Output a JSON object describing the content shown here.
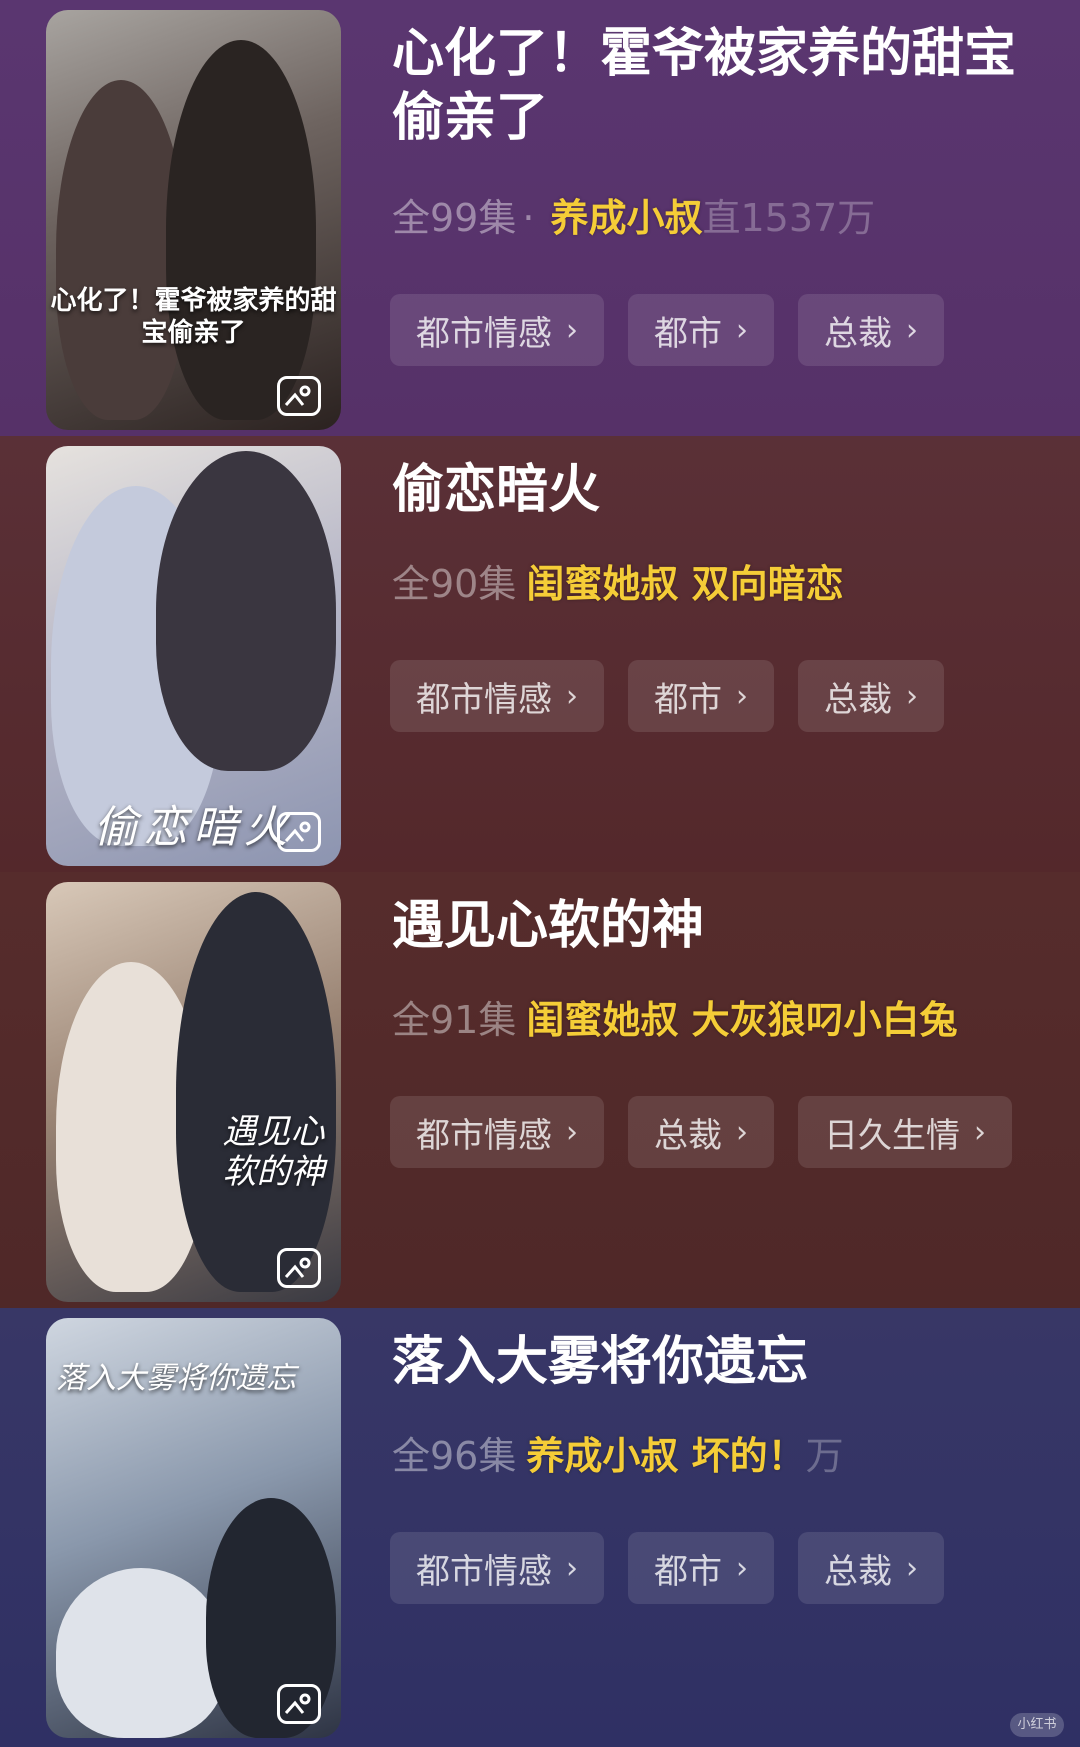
{
  "dramas": [
    {
      "title": "心化了！霍爷被家养的甜宝偷亲了",
      "poster_caption": "心化了！霍爷被家养的甜宝偷亲了",
      "episodes": "全99集",
      "separator": "·",
      "highlight": "养成小叔",
      "faded_tail": "直1537万",
      "tags": [
        "都市情感",
        "都市",
        "总裁"
      ]
    },
    {
      "title": "偷恋暗火",
      "poster_caption": "偷恋暗火",
      "episodes": "全90集",
      "separator": "",
      "highlight": "闺蜜她叔 双向暗恋",
      "faded_tail": "",
      "tags": [
        "都市情感",
        "都市",
        "总裁"
      ]
    },
    {
      "title": "遇见心软的神",
      "poster_caption": "遇见心软的神",
      "episodes": "全91集",
      "separator": "",
      "highlight": "闺蜜她叔 大灰狼叼小白兔",
      "faded_tail": "",
      "tags": [
        "都市情感",
        "总裁",
        "日久生情"
      ]
    },
    {
      "title": "落入大雾将你遗忘",
      "poster_caption": "落入大雾将你遗忘",
      "episodes": "全96集",
      "separator": "",
      "highlight": "养成小叔 坏的！",
      "faded_tail": "万",
      "tags": [
        "都市情感",
        "都市",
        "总裁"
      ]
    }
  ],
  "chevron": "›",
  "watermark": "小红书",
  "icons": {
    "gallery": "gallery-icon",
    "chevron": "chevron-right-icon"
  },
  "colors": {
    "highlight": "#f5cd37",
    "card1": "#5a3670",
    "card2": "#5a3037",
    "card3": "#562c2c",
    "card4": "#383766"
  }
}
